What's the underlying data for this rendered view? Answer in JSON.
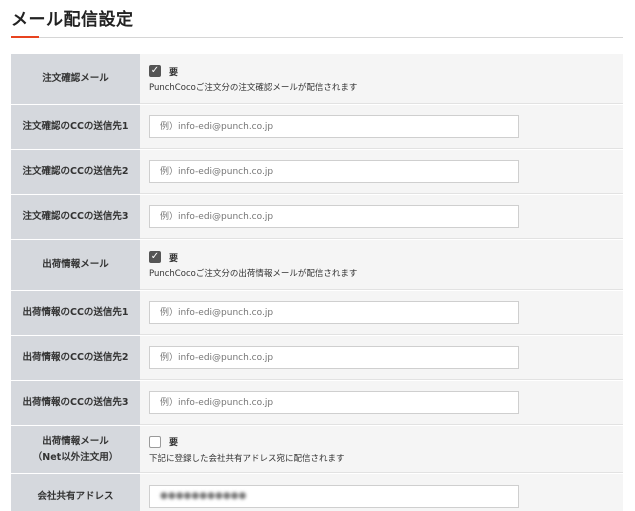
{
  "page": {
    "title": "メール配信設定"
  },
  "rows": [
    {
      "label": "注文確認メール",
      "type": "checkbox",
      "checked": true,
      "check_label": "要",
      "note": "PunchCocoご注文分の注文確認メールが配信されます"
    },
    {
      "label": "注文確認のCCの送信先1",
      "type": "input",
      "value": "",
      "placeholder": "例）info-edi@punch.co.jp"
    },
    {
      "label": "注文確認のCCの送信先2",
      "type": "input",
      "value": "",
      "placeholder": "例）info-edi@punch.co.jp"
    },
    {
      "label": "注文確認のCCの送信先3",
      "type": "input",
      "value": "",
      "placeholder": "例）info-edi@punch.co.jp"
    },
    {
      "label": "出荷情報メール",
      "type": "checkbox",
      "checked": true,
      "check_label": "要",
      "note": "PunchCocoご注文分の出荷情報メールが配信されます"
    },
    {
      "label": "出荷情報のCCの送信先1",
      "type": "input",
      "value": "",
      "placeholder": "例）info-edi@punch.co.jp"
    },
    {
      "label": "出荷情報のCCの送信先2",
      "type": "input",
      "value": "",
      "placeholder": "例）info-edi@punch.co.jp"
    },
    {
      "label": "出荷情報のCCの送信先3",
      "type": "input",
      "value": "",
      "placeholder": "例）info-edi@punch.co.jp"
    },
    {
      "label_line1": "出荷情報メール",
      "label_line2": "（Net以外注文用）",
      "type": "checkbox",
      "checked": false,
      "check_label": "要",
      "note": "下記に登録した会社共有アドレス宛に配信されます"
    },
    {
      "label": "会社共有アドレス",
      "type": "input",
      "value": "●●●●●●●●●●●",
      "placeholder": ""
    }
  ],
  "colors": {
    "accent": "#e8431f",
    "label_bg": "#d5d8dd",
    "body_bg": "#f5f5f5"
  }
}
